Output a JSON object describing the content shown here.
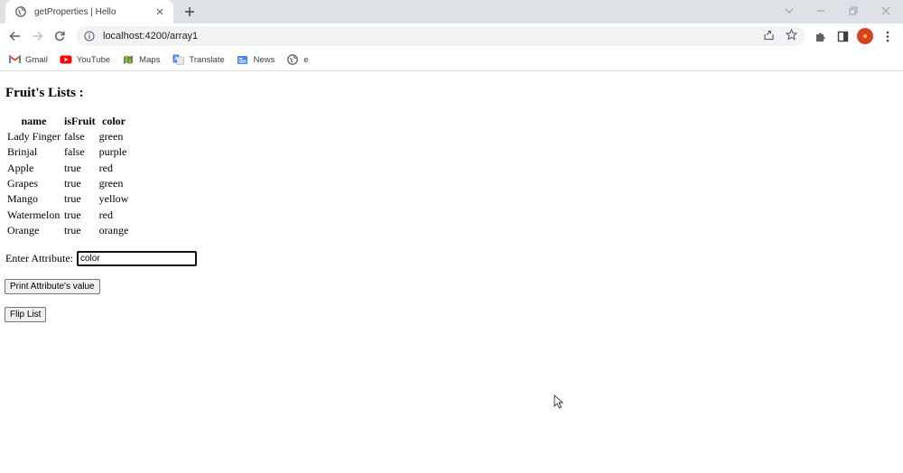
{
  "browser": {
    "tab_title": "getProperties | Hello",
    "url": "localhost:4200/array1",
    "bookmarks": [
      {
        "label": "Gmail",
        "icon": "gmail-icon"
      },
      {
        "label": "YouTube",
        "icon": "youtube-icon"
      },
      {
        "label": "Maps",
        "icon": "maps-icon"
      },
      {
        "label": "Translate",
        "icon": "translate-icon"
      },
      {
        "label": "News",
        "icon": "news-icon"
      },
      {
        "label": "e",
        "icon": "globe-icon"
      }
    ]
  },
  "page": {
    "heading": "Fruit's Lists :",
    "table": {
      "headers": [
        "name",
        "isFruit",
        "color"
      ],
      "rows": [
        [
          "Lady Finger",
          "false",
          "green"
        ],
        [
          "Brinjal",
          "false",
          "purple"
        ],
        [
          "Apple",
          "true",
          "red"
        ],
        [
          "Grapes",
          "true",
          "green"
        ],
        [
          "Mango",
          "true",
          "yellow"
        ],
        [
          "Watermelon",
          "true",
          "red"
        ],
        [
          "Orange",
          "true",
          "orange"
        ]
      ]
    },
    "attribute_label": "Enter Attribute:",
    "attribute_value": "color",
    "print_button": "Print Attribute's value",
    "flip_button": "Flip List"
  },
  "colors": {
    "tabstrip_bg": "#dee1e6",
    "omnibox_bg": "#f1f3f4",
    "avatar": "#d5441c"
  }
}
